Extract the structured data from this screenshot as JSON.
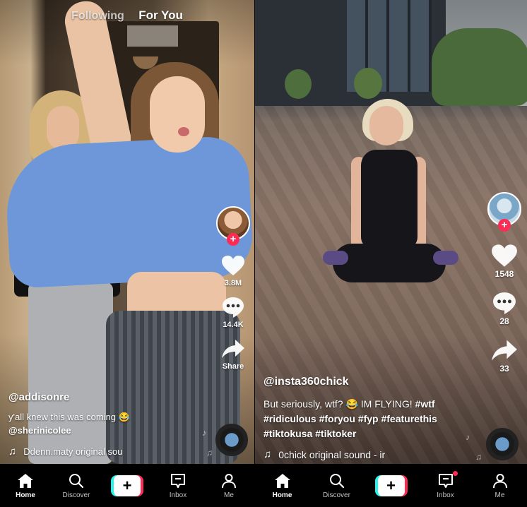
{
  "left": {
    "top_tabs": {
      "following": "Following",
      "for_you": "For You"
    },
    "video": {
      "username": "@addisonre",
      "description": "y'all knew this was coming 😂",
      "mention": "@sherinicolee",
      "sound_text": "Ddenn.maty    original sou"
    },
    "rail": {
      "likes": "3.8M",
      "comments": "14.4K",
      "share": "Share"
    },
    "nav": {
      "home": "Home",
      "discover": "Discover",
      "inbox": "Inbox",
      "me": "Me",
      "create": "+"
    }
  },
  "right": {
    "video": {
      "username": "@insta360chick",
      "description_plain": "But seriously, wtf? 😂 IM FLYING!",
      "hashtags_line1": "#wtf",
      "hashtags_line2": "#ridiculous #foryou #fyp #featurethis",
      "hashtags_line3": "#tiktokusa #tiktoker",
      "sound_text": "0chick    original sound - ir"
    },
    "rail": {
      "likes": "1548",
      "comments": "28",
      "shares": "33"
    },
    "nav": {
      "home": "Home",
      "discover": "Discover",
      "inbox": "Inbox",
      "me": "Me",
      "create": "+"
    }
  },
  "colors": {
    "accent_red": "#fe2c55",
    "accent_cyan": "#25f4ee",
    "nav_bg": "#000000",
    "text": "#ffffff"
  },
  "icons": {
    "like": "heart-icon",
    "comment": "comment-icon",
    "share": "share-arrow-icon",
    "music": "music-note-icon",
    "home": "home-icon",
    "discover": "search-icon",
    "inbox": "inbox-icon",
    "me": "profile-icon"
  }
}
